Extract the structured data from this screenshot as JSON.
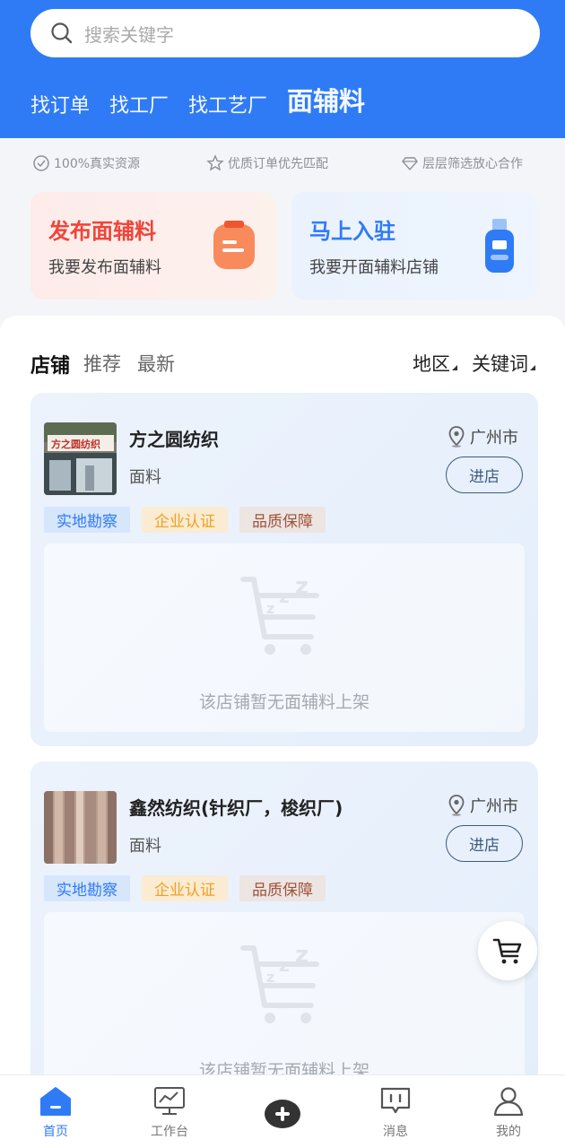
{
  "header": {
    "search_placeholder": "搜索关键字",
    "tabs": [
      "找订单",
      "找工厂",
      "找工艺厂",
      "面辅料"
    ],
    "active_tab": "面辅料"
  },
  "features": [
    "100%真实资源",
    "优质订单优先匹配",
    "层层筛选放心合作"
  ],
  "promos": {
    "publish": {
      "title": "发布面辅料",
      "subtitle": "我要发布面辅料"
    },
    "join": {
      "title": "马上入驻",
      "subtitle": "我要开面辅料店铺"
    }
  },
  "filter": {
    "tabs": [
      "店铺",
      "推荐",
      "最新"
    ],
    "active": "店铺",
    "region": "地区",
    "keyword": "关键词"
  },
  "shops": [
    {
      "name": "方之圆纺织",
      "category": "面料",
      "location": "广州市",
      "enter_label": "进店",
      "tags": [
        "实地勘察",
        "企业认证",
        "品质保障"
      ],
      "empty_text": "该店铺暂无面辅料上架"
    },
    {
      "name": "鑫然纺织(针织厂，梭织厂)",
      "category": "面料",
      "location": "广州市",
      "enter_label": "进店",
      "tags": [
        "实地勘察",
        "企业认证",
        "品质保障"
      ],
      "empty_text": "该店铺暂无面辅料上架"
    }
  ],
  "tabbar": [
    "首页",
    "工作台",
    "",
    "消息",
    "我的"
  ],
  "colors": {
    "primary": "#2f7bf6",
    "accent_red": "#f0453a",
    "tag_orange": "#f0a020"
  }
}
